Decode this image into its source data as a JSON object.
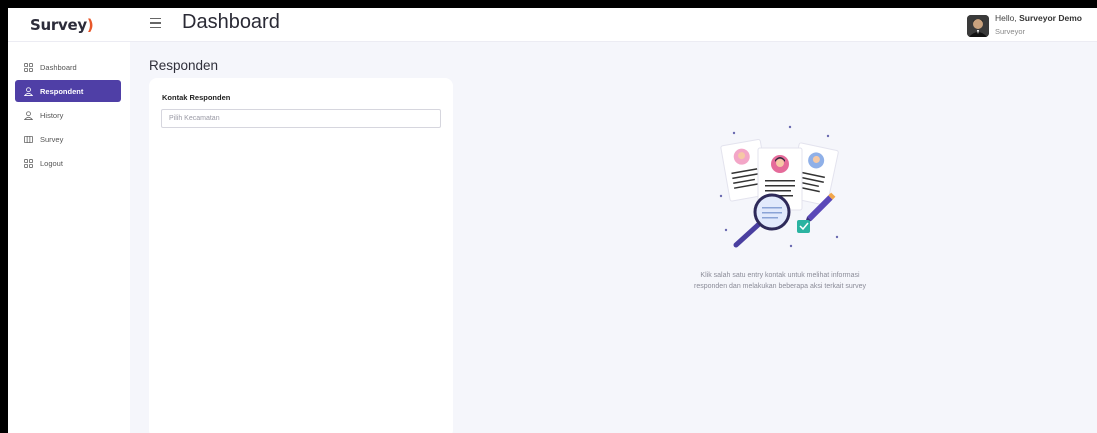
{
  "app": {
    "logo_text": "Survey",
    "page_title": "Dashboard"
  },
  "user": {
    "greeting": "Hello,",
    "name": "Surveyor Demo",
    "role": "Surveyor"
  },
  "sidebar": {
    "items": [
      {
        "label": "Dashboard",
        "icon": "grid-icon",
        "active": false
      },
      {
        "label": "Respondent",
        "icon": "user-icon",
        "active": true
      },
      {
        "label": "History",
        "icon": "user-icon",
        "active": false
      },
      {
        "label": "Survey",
        "icon": "columns-icon",
        "active": false
      },
      {
        "label": "Logout",
        "icon": "grid-icon",
        "active": false
      }
    ]
  },
  "main": {
    "section_title": "Responden",
    "panel_title": "Kontak Responden",
    "district_select_placeholder": "Pilih Kecamatan",
    "empty_state_line1": "Klik salah satu entry kontak untuk melihat informasi",
    "empty_state_line2": "responden dan melakukan beberapa aksi terkait survey"
  },
  "colors": {
    "accent": "#4f3fa6",
    "logo_accent": "#e8572a",
    "background": "#f5f6fb"
  }
}
